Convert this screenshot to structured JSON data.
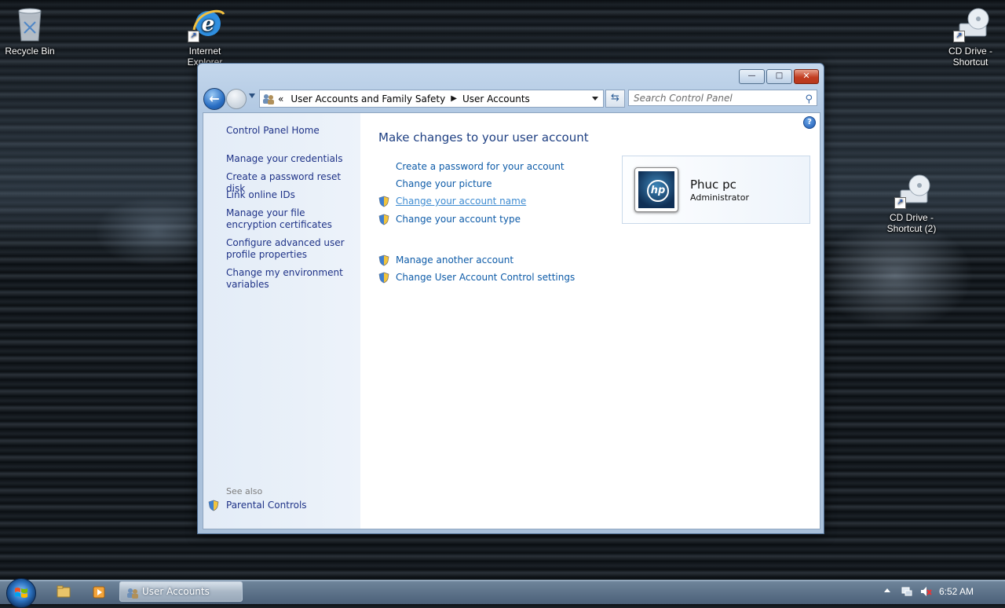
{
  "desktop": {
    "icons": [
      {
        "label": "Recycle Bin"
      },
      {
        "label": "Internet Explorer"
      },
      {
        "label": "CD Drive - Shortcut"
      },
      {
        "label": "CD Drive - Shortcut (2)"
      }
    ]
  },
  "window": {
    "controls": {
      "minimize": "—",
      "maximize": "□",
      "close": "✕"
    },
    "address": {
      "overflow": "«",
      "crumbs": [
        "User Accounts and Family Safety",
        "User Accounts"
      ],
      "separator": "▶"
    },
    "search": {
      "placeholder": "Search Control Panel"
    },
    "sidebar": {
      "links": [
        "Control Panel Home",
        "Manage your credentials",
        "Create a password reset disk",
        "Link online IDs",
        "Manage your file encryption certificates",
        "Configure advanced user profile properties",
        "Change my environment variables"
      ],
      "see_also": "See also",
      "see_also_links": [
        "Parental Controls"
      ]
    },
    "main": {
      "heading": "Make changes to your user account",
      "tasks": [
        {
          "label": "Create a password for your account",
          "shield": false
        },
        {
          "label": "Change your picture",
          "shield": false
        },
        {
          "label": "Change your account name",
          "shield": true
        },
        {
          "label": "Change your account type",
          "shield": true
        },
        {
          "label": "Manage another account",
          "shield": true
        },
        {
          "label": "Change User Account Control settings",
          "shield": true
        }
      ],
      "user": {
        "name": "Phuc pc",
        "role": "Administrator",
        "picture_logo": "hp"
      }
    }
  },
  "taskbar": {
    "active_task": "User Accounts",
    "clock": "6:52 AM"
  },
  "colors": {
    "link": "#0d5ba8",
    "heading": "#1e3f82",
    "sidebar_link": "#1e3287"
  }
}
